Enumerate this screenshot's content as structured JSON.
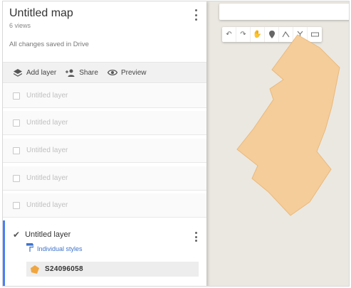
{
  "map": {
    "title": "Untitled map",
    "views": "6 views",
    "saved_status": "All changes saved in Drive"
  },
  "actions": [
    {
      "label": "Add layer",
      "icon": "add-layer-icon"
    },
    {
      "label": "Share",
      "icon": "add-person-icon"
    },
    {
      "label": "Preview",
      "icon": "eye-icon"
    }
  ],
  "layers": [
    {
      "label": "Untitled layer",
      "checked": false
    },
    {
      "label": "Untitled layer",
      "checked": false
    },
    {
      "label": "Untitled layer",
      "checked": false
    },
    {
      "label": "Untitled layer",
      "checked": false
    },
    {
      "label": "Untitled layer",
      "checked": false
    }
  ],
  "active_layer": {
    "label": "Untitled layer",
    "checked": true,
    "style_link": "Individual styles",
    "feature": "S24096058"
  },
  "toolbar": {
    "tools": [
      "undo-icon",
      "redo-icon",
      "hand-icon",
      "marker-icon",
      "draw-line-icon",
      "route-icon",
      "ruler-icon"
    ]
  },
  "colors": {
    "accent": "#4a80f5",
    "link": "#3f73cc",
    "polygon_fill": "#f5cd9a",
    "map_background": "#ebe8e2"
  }
}
